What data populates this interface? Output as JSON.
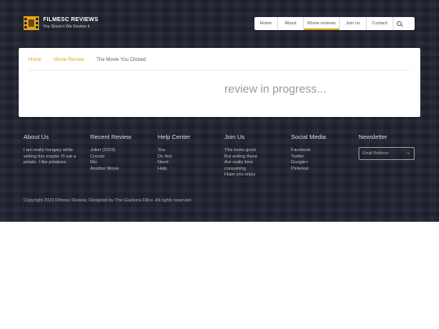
{
  "brand": {
    "title": "FILMESC REVIEWS",
    "tagline": "You Shoot it We Review it"
  },
  "nav": {
    "items": [
      {
        "label": "Home"
      },
      {
        "label": "About"
      },
      {
        "label": "Movie reviews",
        "active": true
      },
      {
        "label": "Join us"
      },
      {
        "label": "Contact"
      }
    ],
    "search_icon": "search-icon"
  },
  "breadcrumb": {
    "items": [
      "Home",
      "Movie Review"
    ],
    "current": "The Movie You Clicked",
    "separator": "→"
  },
  "main": {
    "status": "review in progress..."
  },
  "footer": {
    "about": {
      "heading": "About Us",
      "text": "I am really hungary while writing this maybe I'll eat a potato, I like potatoes"
    },
    "recent": {
      "heading": "Recent Review",
      "items": [
        "Joker (2019)",
        "Croods",
        "Rio",
        "Another Movie"
      ]
    },
    "help": {
      "heading": "Help Center",
      "items": [
        "You",
        "Do Not",
        "Need",
        "Help"
      ]
    },
    "join": {
      "heading": "Join Us",
      "items": [
        "This looks good",
        "But writing these",
        "Are really time",
        "consuming",
        "Hope you enjoy"
      ]
    },
    "social": {
      "heading": "Social Media",
      "items": [
        "Facebook",
        "Twitter",
        "Google+",
        "Pinterest"
      ]
    },
    "newsletter": {
      "heading": "Newsletter",
      "placeholder": "Email Address",
      "submit_glyph": "→"
    },
    "copyright": "Copyright 2023 Filmesc Review, Designed by The Gianluca Filice. All rights reserved"
  },
  "colors": {
    "accent": "#e5a51d",
    "hero_bg": "#1f2430"
  }
}
